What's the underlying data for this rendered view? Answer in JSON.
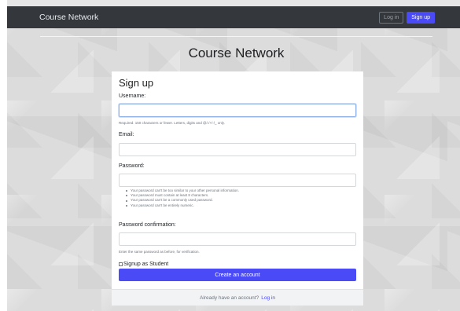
{
  "navbar": {
    "brand": "Course Network",
    "login_label": "Log in",
    "signup_label": "Sign up"
  },
  "page_title": "Course Network",
  "form": {
    "title": "Sign up",
    "username": {
      "label": "Username:",
      "value": "",
      "help": "Required. 150 characters or fewer. Letters, digits and @/./+/-/_ only."
    },
    "email": {
      "label": "Email:",
      "value": ""
    },
    "password": {
      "label": "Password:",
      "value": "",
      "rules": [
        "Your password can't be too similar to your other personal information.",
        "Your password must contain at least 8 characters.",
        "Your password can't be a commonly used password.",
        "Your password can't be entirely numeric."
      ]
    },
    "password_confirmation": {
      "label": "Password confirmation:",
      "value": "",
      "help": "Enter the same password as before, for verification."
    },
    "student_checkbox": {
      "label": "Signup as Student",
      "checked": false
    },
    "submit_label": "Create an account"
  },
  "footer": {
    "text": "Already have an account?",
    "link_label": "Log in"
  },
  "colors": {
    "primary": "#4a4bf6",
    "navbar": "#34373b"
  }
}
